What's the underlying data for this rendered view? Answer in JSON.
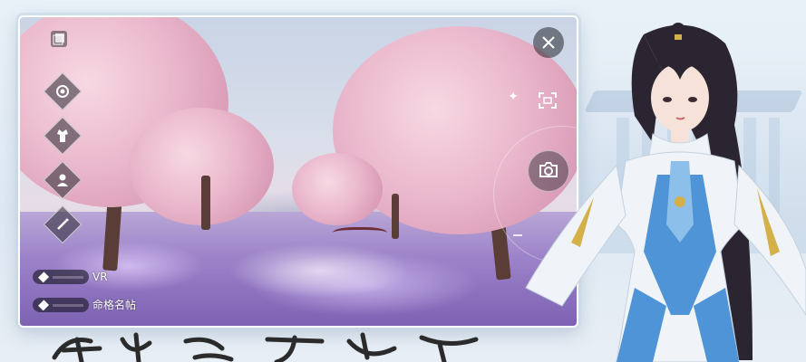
{
  "screen": {
    "toolbar": {
      "items": [
        {
          "name": "gallery-icon"
        },
        {
          "name": "settings-icon"
        },
        {
          "name": "costume-icon"
        },
        {
          "name": "character-icon"
        },
        {
          "name": "magic-wand-icon"
        }
      ]
    },
    "options": [
      {
        "label": "VR"
      },
      {
        "label": "命格名帖"
      }
    ],
    "controls": {
      "close_icon": "close-icon",
      "frame_icon": "frame-icon",
      "camera_icon": "camera-icon"
    }
  },
  "colors": {
    "blossom": "#eab8cc",
    "meadow": "#9c83c9",
    "sky": "#c9d4e6",
    "accent_blue": "#4a90d9"
  }
}
